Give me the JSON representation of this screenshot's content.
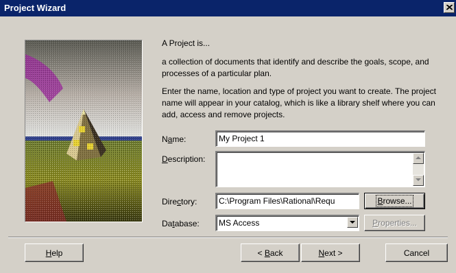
{
  "window": {
    "title": "Project Wizard",
    "close_icon": "close-x-icon"
  },
  "intro": {
    "heading": "A Project is...",
    "definition": "a collection of documents that identify and describe the goals, scope, and processes of a particular plan.",
    "instructions": "Enter the name, location and type of project you want to create. The project name will appear in your catalog, which is like a library shelf where you can add, access and remove projects."
  },
  "form": {
    "name_label_pre": "N",
    "name_label_acc": "a",
    "name_label_post": "me:",
    "name_value": "My Project 1",
    "description_label_pre": "",
    "description_label_acc": "D",
    "description_label_post": "escription:",
    "description_value": "",
    "directory_label_pre": "Dire",
    "directory_label_acc": "c",
    "directory_label_post": "tory:",
    "directory_value": "C:\\Program Files\\Rational\\Requ",
    "database_label_pre": "Da",
    "database_label_acc": "t",
    "database_label_post": "abase:",
    "database_value": "MS Access"
  },
  "buttons": {
    "browse_acc": "B",
    "browse_rest": "rowse...",
    "properties_acc": "P",
    "properties_rest": "roperties...",
    "help_acc": "H",
    "help_rest": "elp",
    "back_pre": "< ",
    "back_acc": "B",
    "back_rest": "ack",
    "next_acc": "N",
    "next_rest": "ext >",
    "cancel": "Cancel"
  },
  "colors": {
    "title_bar": "#0a246a",
    "dialog_bg": "#d4d0c8"
  }
}
